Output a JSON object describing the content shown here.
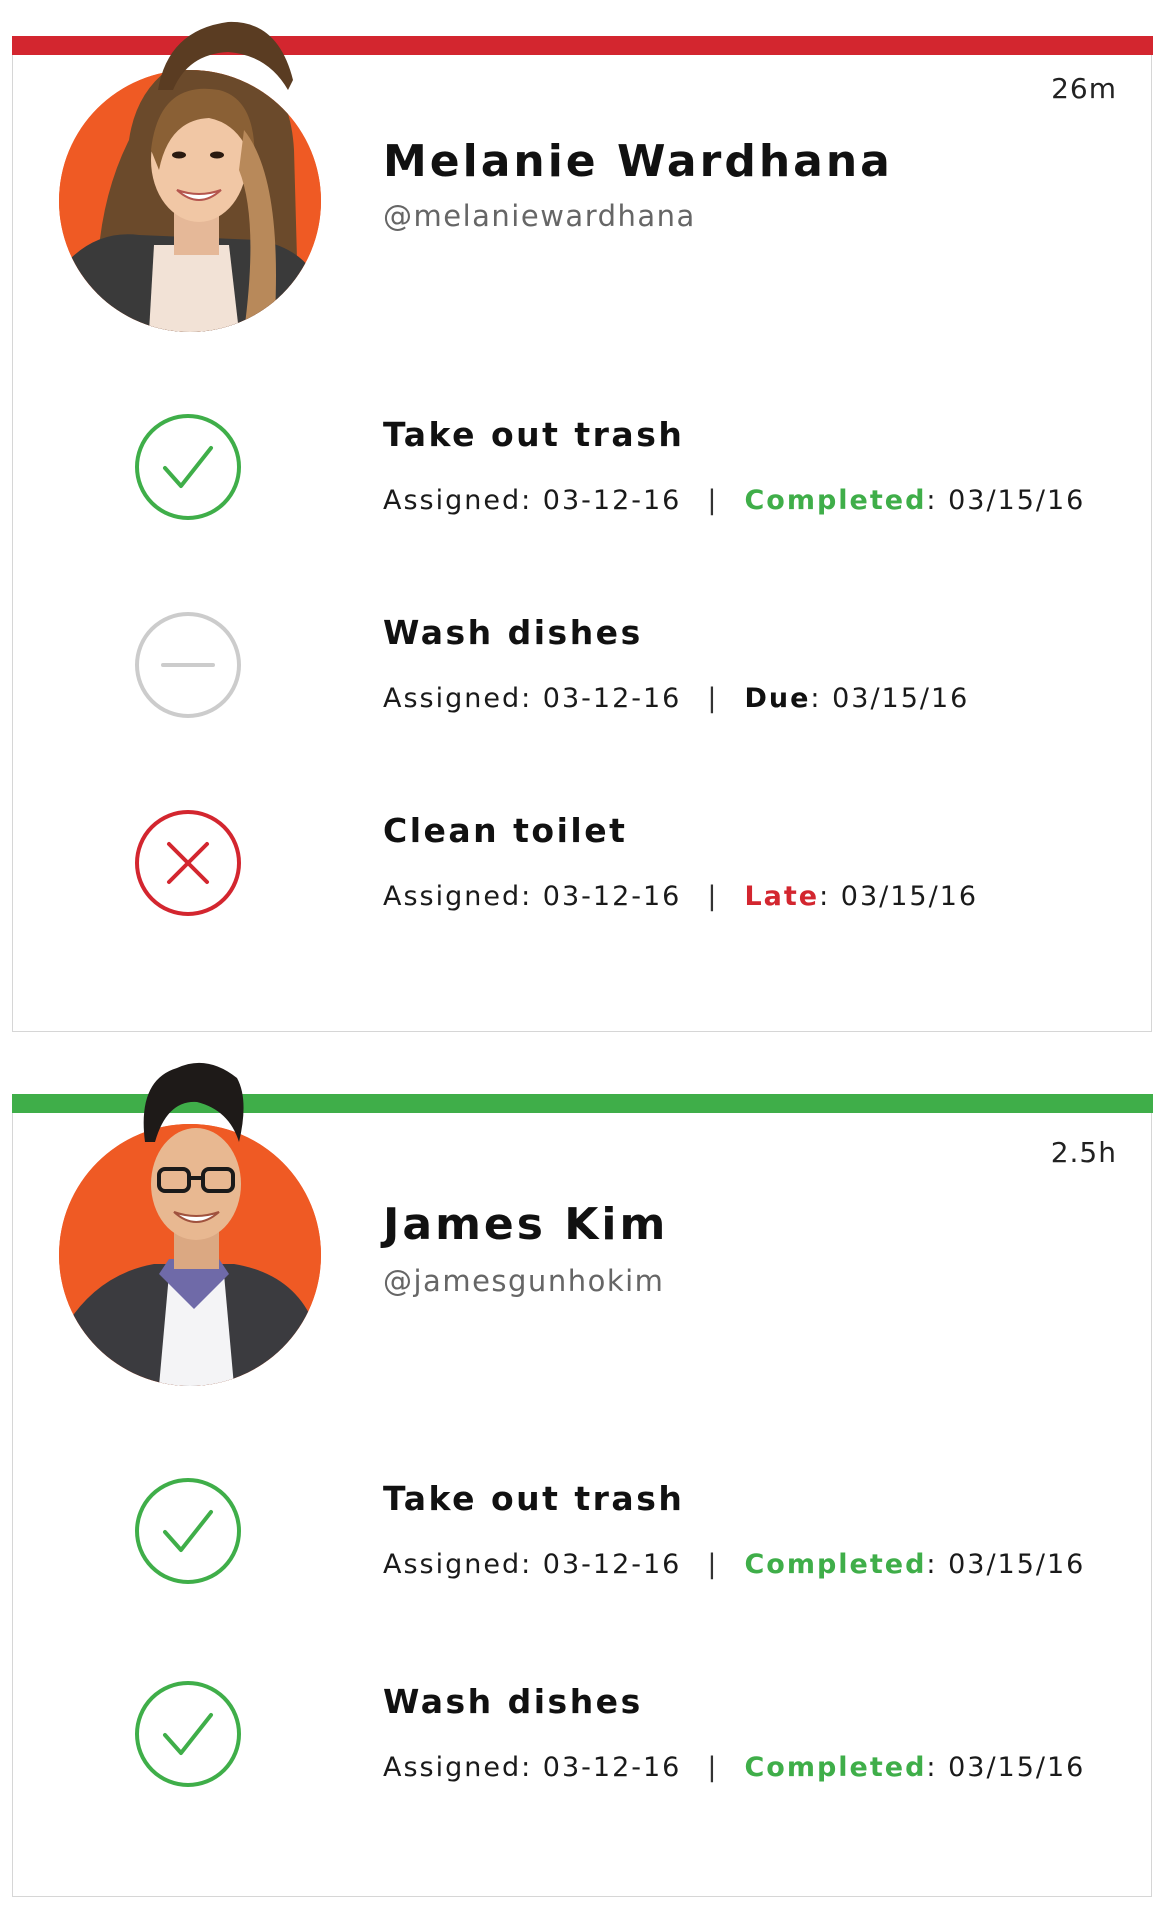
{
  "colors": {
    "late_bar": "#d3262f",
    "ontime_bar": "#3fae49",
    "completed": "#3fae49",
    "late": "#d3262f",
    "pending": "#cccccc",
    "avatar_bg": "#ef5a24"
  },
  "cards": [
    {
      "bar_status": "late",
      "timestamp": "26m",
      "name": "Melanie Wardhana",
      "handle": "@melaniewardhana",
      "avatar_icon": "profile-photo",
      "tasks": [
        {
          "icon": "check-circle-icon",
          "title": "Take out trash",
          "assigned_label": "Assigned: 03-12-16",
          "separator": "|",
          "status_label": "Completed",
          "status_rest": ": 03/15/16"
        },
        {
          "icon": "minus-circle-icon",
          "title": "Wash dishes",
          "assigned_label": "Assigned: 03-12-16",
          "separator": "|",
          "status_label": "Due",
          "status_rest": ": 03/15/16"
        },
        {
          "icon": "x-circle-icon",
          "title": "Clean toilet",
          "assigned_label": "Assigned: 03-12-16",
          "separator": "|",
          "status_label": "Late",
          "status_rest": ": 03/15/16"
        }
      ]
    },
    {
      "bar_status": "on-time",
      "timestamp": "2.5h",
      "name": "James Kim",
      "handle": "@jamesgunhokim",
      "avatar_icon": "profile-photo",
      "tasks": [
        {
          "icon": "check-circle-icon",
          "title": "Take out trash",
          "assigned_label": "Assigned: 03-12-16",
          "separator": "|",
          "status_label": "Completed",
          "status_rest": ": 03/15/16"
        },
        {
          "icon": "check-circle-icon",
          "title": "Wash dishes",
          "assigned_label": "Assigned: 03-12-16",
          "separator": "|",
          "status_label": "Completed",
          "status_rest": ": 03/15/16"
        }
      ]
    }
  ]
}
